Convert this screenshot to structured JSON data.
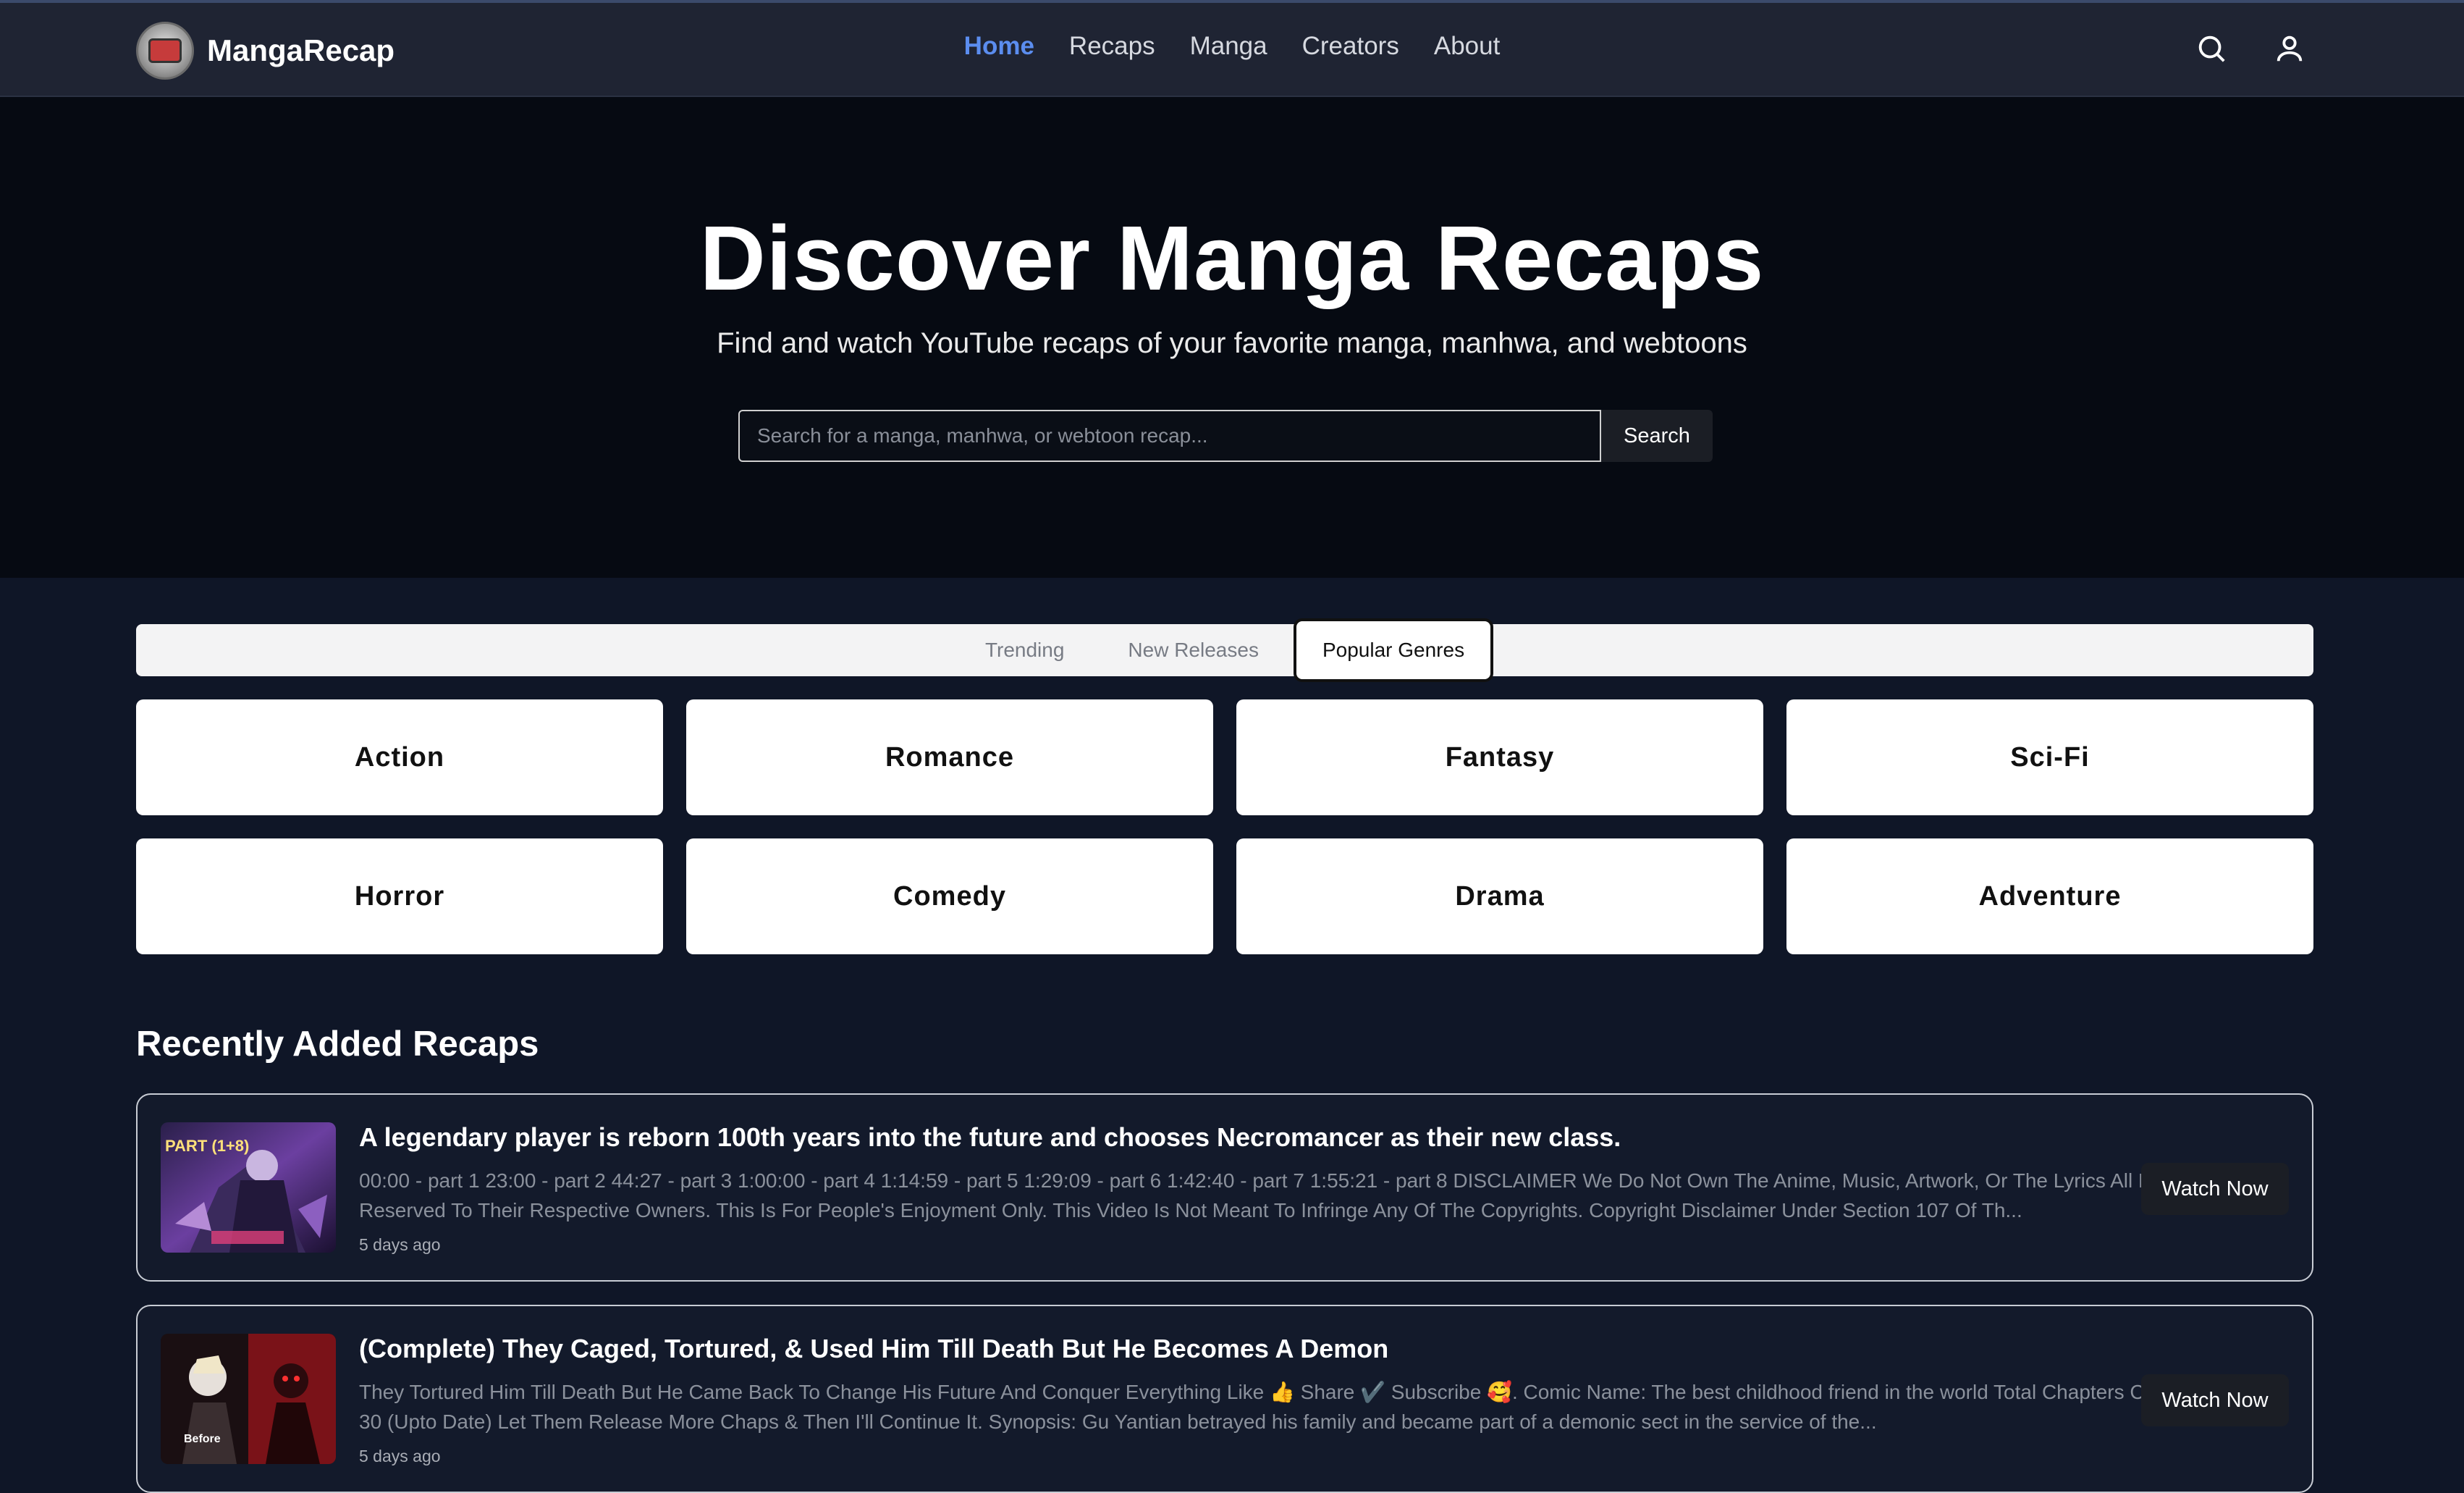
{
  "header": {
    "brand": "MangaRecap",
    "nav": [
      {
        "label": "Home",
        "active": true
      },
      {
        "label": "Recaps"
      },
      {
        "label": "Manga"
      },
      {
        "label": "Creators"
      },
      {
        "label": "About"
      }
    ],
    "icons": [
      "search-icon",
      "user-icon"
    ]
  },
  "hero": {
    "title": "Discover Manga Recaps",
    "subtitle": "Find and watch YouTube recaps of your favorite manga, manhwa, and webtoons",
    "search_placeholder": "Search for a manga, manhwa, or webtoon recap...",
    "search_button": "Search"
  },
  "tabs": [
    {
      "label": "Trending"
    },
    {
      "label": "New Releases"
    },
    {
      "label": "Popular Genres",
      "active": true
    }
  ],
  "genres": [
    "Action",
    "Romance",
    "Fantasy",
    "Sci-Fi",
    "Horror",
    "Comedy",
    "Drama",
    "Adventure"
  ],
  "recent": {
    "title": "Recently Added Recaps",
    "items": [
      {
        "title": "A legendary player is reborn 100th years into the future and chooses Necromancer as their new class.",
        "description": "00:00 - part 1 23:00 - part 2 44:27 - part 3 1:00:00 - part 4 1:14:59 - part 5 1:29:09 - part 6 1:42:40 - part 7 1:55:21 - part 8 DISCLAIMER We Do Not Own The Anime, Music, Artwork, Or The Lyrics All Rights Reserved To Their Respective Owners. This Is For People's Enjoyment Only. This Video Is Not Meant To Infringe Any Of The Copyrights. Copyright Disclaimer Under Section 107 Of Th...",
        "time": "5 days ago",
        "button": "Watch Now",
        "thumb_label": "PART (1+8)"
      },
      {
        "title": "(Complete) They Caged, Tortured, & Used Him Till Death But He Becomes A Demon",
        "description": "They Tortured Him Till Death But He Came Back To Change His Future And Conquer Everything Like 👍 Share ✔️ Subscribe 🥰. Comic Name: The best childhood friend in the world Total Chapters Covered = 1 - 30 (Upto Date) Let Them Release More Chaps & Then I'll Continue It. Synopsis: Gu Yantian betrayed his family and became part of a demonic sect in the service of the...",
        "time": "5 days ago",
        "button": "Watch Now",
        "thumb_label": "Before"
      }
    ]
  }
}
